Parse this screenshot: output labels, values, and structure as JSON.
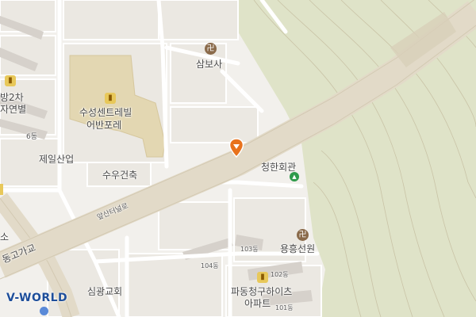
{
  "map": {
    "places": {
      "sambosa": "삼보사",
      "suseong_central": "수성센트레빌",
      "eobanporae": "어반포레",
      "jeil_industry": "제일산업",
      "suwoo_construction": "수우건축",
      "cheonghan_hall": "청한회관",
      "yongheungseonwon": "용흥선원",
      "simgwang_church": "심광교회",
      "padong_apt_line1": "파동청구하이츠",
      "padong_apt_line2": "아파트",
      "left_apt_top": "방2차",
      "left_apt_bottom": "자연별",
      "left_edge_so": "소"
    },
    "buildings": {
      "dong_6": "6동",
      "dong_104": "104동",
      "dong_103": "103동",
      "dong_102": "102동",
      "dong_101": "101동"
    },
    "roads": {
      "apsan_tunnel": "앞산터널로",
      "overpass": "동고가교"
    },
    "icons": {
      "temple": "卍",
      "building": "🏢",
      "park": "▲",
      "marker": "location-pin"
    },
    "watermark": "V-WORLD",
    "colors": {
      "ground": "#f2f0ec",
      "road": "#e2dac8",
      "mountain": "#dfe3c8",
      "contour": "#c9c3a6",
      "marker": "#e8721c",
      "watermark": "#1e4e9a"
    }
  }
}
